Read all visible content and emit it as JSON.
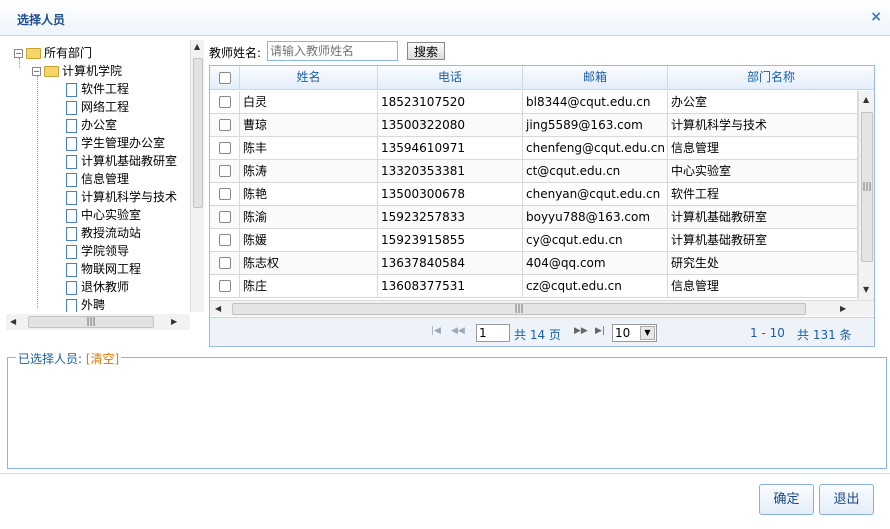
{
  "dialog": {
    "title": "选择人员",
    "close": "×"
  },
  "tree": {
    "root": "所有部门",
    "college": "计算机学院",
    "items": [
      "软件工程",
      "网络工程",
      "办公室",
      "学生管理办公室",
      "计算机基础教研室",
      "信息管理",
      "计算机科学与技术",
      "中心实验室",
      "教授流动站",
      "学院领导",
      "物联网工程",
      "退休教师",
      "外聘"
    ]
  },
  "search": {
    "label": "教师姓名:",
    "placeholder": "请输入教师姓名",
    "button": "搜索"
  },
  "grid": {
    "columns": [
      "姓名",
      "电话",
      "邮箱",
      "部门名称"
    ],
    "rows": [
      {
        "name": "白灵",
        "phone": "18523107520",
        "email": "bl8344@cqut.edu.cn",
        "dept": "办公室"
      },
      {
        "name": "曹琼",
        "phone": "13500322080",
        "email": "jing5589@163.com",
        "dept": "计算机科学与技术"
      },
      {
        "name": "陈丰",
        "phone": "13594610971",
        "email": "chenfeng@cqut.edu.cn",
        "dept": "信息管理"
      },
      {
        "name": "陈涛",
        "phone": "13320353381",
        "email": "ct@cqut.edu.cn",
        "dept": "中心实验室"
      },
      {
        "name": "陈艳",
        "phone": "13500300678",
        "email": "chenyan@cqut.edu.cn",
        "dept": "软件工程"
      },
      {
        "name": "陈渝",
        "phone": "15923257833",
        "email": "boyyu788@163.com",
        "dept": "计算机基础教研室"
      },
      {
        "name": "陈媛",
        "phone": "15923915855",
        "email": "cy@cqut.edu.cn",
        "dept": "计算机基础教研室"
      },
      {
        "name": "陈志权",
        "phone": "13637840584",
        "email": "404@qq.com",
        "dept": "研究生处"
      },
      {
        "name": "陈庄",
        "phone": "13608377531",
        "email": "cz@cqut.edu.cn",
        "dept": "信息管理"
      }
    ]
  },
  "pager": {
    "page": "1",
    "total_pages_text": "共 14 页",
    "page_size": "10",
    "range": "1 - 10",
    "total_text": "共 131 条"
  },
  "selected": {
    "label": "已选择人员:",
    "clear": "[清空]"
  },
  "footer": {
    "confirm": "确定",
    "exit": "退出"
  }
}
